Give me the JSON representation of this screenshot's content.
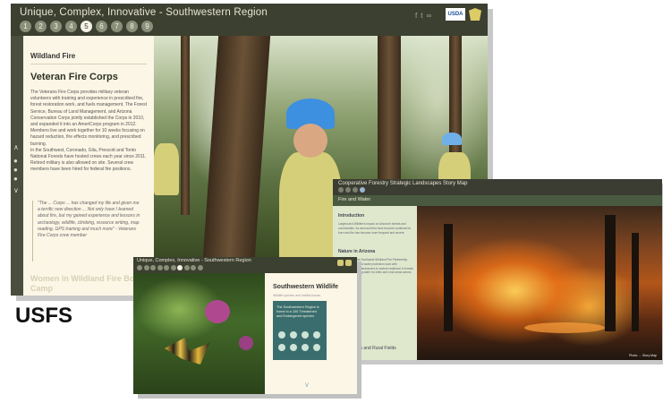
{
  "label": "USFS",
  "screen1": {
    "title": "Unique, Complex, Innovative - Southwestern Region",
    "steps": [
      "1",
      "2",
      "3",
      "4",
      "5",
      "6",
      "7",
      "8",
      "9"
    ],
    "active_step": 5,
    "section": "Wildland Fire",
    "heading": "Veteran Fire Corps",
    "body_link": "Veterans Fire Corps",
    "body": "The Veterans Fire Corps provides military veteran volunteers with training and experience in prescribed fire, forest restoration work, and fuels management. The Forest Service, Bureau of Land Management, and Arizona Conservation Corps jointly established the Corps in 2010, and expanded it into an AmeriCorps program in 2012. Members live and work together for 10 weeks focusing on hazard reduction, fire effects monitoring, and prescribed burning.",
    "body2": "In the Southwest, Coronado, Gila, Prescott and Tonto National Forests have hosted crews each year since 2011. Retired military is also allowed on site. Several crew members have been hired for federal fire positions.",
    "quote": "\"The ... Corps ... has changed my life and given me a terrific new direction ... Not only have I learned about fire, but my gained experience and lessons in archeology, wildlife, climbing, resource writing, map reading, GPS training and much more\" - Veterans Fire Corps crew member",
    "next_heading": "Women in Wildland Fire Boot Camp",
    "share_icons": [
      "facebook-icon",
      "twitter-icon",
      "link-icon"
    ],
    "usda_text": "USDA"
  },
  "screen2": {
    "title": "Cooperative Forestry Strategic Landscapes Story Map",
    "subtitle": "Fire and Water",
    "side_sections": [
      {
        "heading": "Introduction",
        "text": "Largest and Wildfire's impact on Arizona's forests and communities. As area and thin have become continued to burn and fire has become more frequent and severe."
      },
      {
        "heading": "Nature in Arizona",
        "text": "Forest land in the Southwest Wildland Fire Partnership. Fuels reduction and water protection work with communities and landowners to restore resilience in forests that supply drinking water for cities and rural areas across the state."
      }
    ],
    "side_footer": "Landscapes and Rural Fields",
    "caption": "Photo: ... Story Map"
  },
  "screen3": {
    "title": "Unique, Complex, Innovative - Southwestern Region",
    "heading": "Southwestern Wildlife",
    "subheading": "Wildlife species and habitat issues",
    "card_text": "The Southwestern Region is home to a 100 Threatened and Endangered species"
  }
}
